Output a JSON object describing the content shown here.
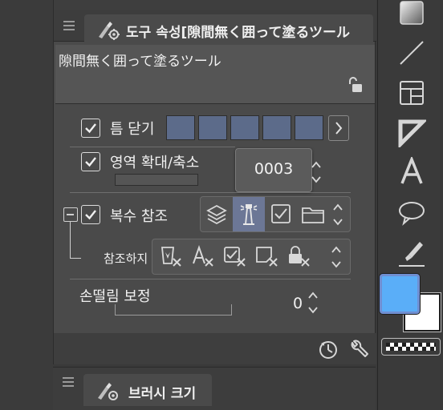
{
  "tool_property": {
    "panel_title": "도구 속성[隙間無く囲って塗るツール",
    "tool_name": "隙間無く囲って塗るツール"
  },
  "gap_closing": {
    "label": "틈 닫기",
    "checked": true
  },
  "area_scaling": {
    "label": "영역 확대/축소",
    "checked": true,
    "value": "0003"
  },
  "multiple_refer": {
    "label": "복수 참조",
    "checked": true
  },
  "refer_layer": {
    "label": "참조하지"
  },
  "antialias_correction": {
    "label": "손떨림 보정",
    "value": "0"
  },
  "brush_size_panel": {
    "title": "브러시 크기"
  },
  "colors": {
    "main_color": "#5aaef8",
    "sub_color": "#ffffff",
    "swatch_color": "#5c6b8a",
    "selected_button": "#6c7796"
  }
}
